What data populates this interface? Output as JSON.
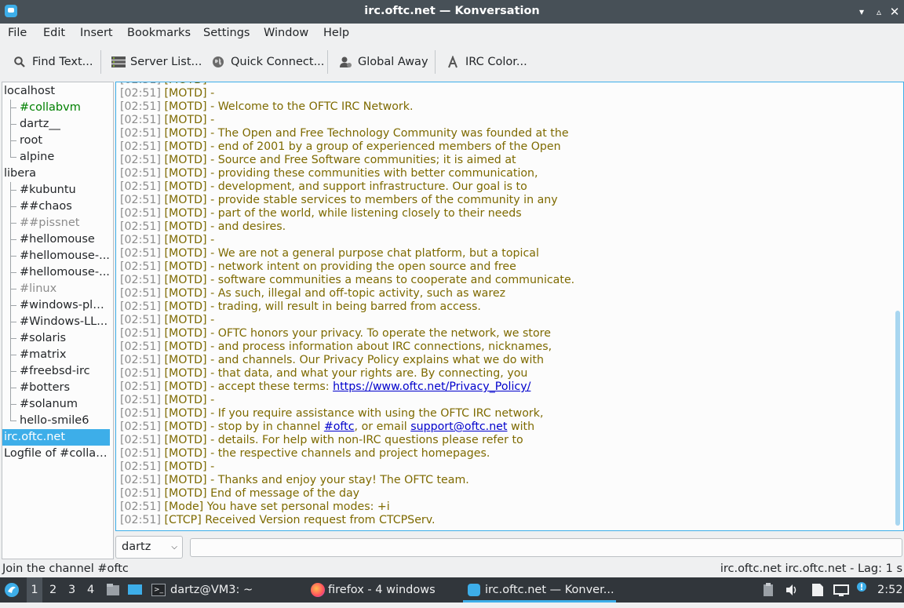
{
  "window": {
    "title": "irc.oftc.net — Konversation"
  },
  "menubar": [
    "File",
    "Edit",
    "Insert",
    "Bookmarks",
    "Settings",
    "Window",
    "Help"
  ],
  "toolbar": {
    "find": "Find Text...",
    "server_list": "Server List...",
    "quick_connect": "Quick Connect...",
    "global_away": "Global Away",
    "irc_color": "IRC Color..."
  },
  "tree": [
    {
      "label": "localhost",
      "level": 0
    },
    {
      "label": "#collabvm",
      "level": 1,
      "color": "#008000"
    },
    {
      "label": "dartz__",
      "level": 1
    },
    {
      "label": "root",
      "level": 1
    },
    {
      "label": "alpine",
      "level": 1
    },
    {
      "label": "libera",
      "level": 0
    },
    {
      "label": "#kubuntu",
      "level": 1
    },
    {
      "label": "##chaos",
      "level": 1
    },
    {
      "label": "##pissnet",
      "level": 1,
      "color": "#8c8c8c"
    },
    {
      "label": "#hellomouse",
      "level": 1
    },
    {
      "label": "#hellomouse-...",
      "level": 1
    },
    {
      "label": "#hellomouse-...",
      "level": 1
    },
    {
      "label": "#linux",
      "level": 1,
      "color": "#8c8c8c"
    },
    {
      "label": "#windows-ple...",
      "level": 1
    },
    {
      "label": "#Windows-LL...",
      "level": 1
    },
    {
      "label": "#solaris",
      "level": 1
    },
    {
      "label": "#matrix",
      "level": 1
    },
    {
      "label": "#freebsd-irc",
      "level": 1
    },
    {
      "label": "#botters",
      "level": 1
    },
    {
      "label": "#solanum",
      "level": 1
    },
    {
      "label": "hello-smile6",
      "level": 1
    },
    {
      "label": "irc.oftc.net",
      "level": 0,
      "selected": true
    },
    {
      "label": "Logfile of #collab...",
      "level": 0
    }
  ],
  "chat": {
    "partial_top": {
      "ts": "[02:51]",
      "tag": "[MOTD]",
      "text": " -"
    },
    "lines": [
      {
        "ts": "[02:51]",
        "tag": "[MOTD]",
        "text": " -"
      },
      {
        "ts": "[02:51]",
        "tag": "[MOTD]",
        "text": " - Welcome to the OFTC IRC Network."
      },
      {
        "ts": "[02:51]",
        "tag": "[MOTD]",
        "text": " -"
      },
      {
        "ts": "[02:51]",
        "tag": "[MOTD]",
        "text": " - The Open and Free Technology Community was founded at the"
      },
      {
        "ts": "[02:51]",
        "tag": "[MOTD]",
        "text": " - end of 2001 by a group of experienced members of the Open"
      },
      {
        "ts": "[02:51]",
        "tag": "[MOTD]",
        "text": " - Source and Free Software communities; it is aimed at"
      },
      {
        "ts": "[02:51]",
        "tag": "[MOTD]",
        "text": " - providing these communities with better communication,"
      },
      {
        "ts": "[02:51]",
        "tag": "[MOTD]",
        "text": " - development, and support infrastructure. Our goal is to"
      },
      {
        "ts": "[02:51]",
        "tag": "[MOTD]",
        "text": " - provide stable services to members of the community in any"
      },
      {
        "ts": "[02:51]",
        "tag": "[MOTD]",
        "text": " - part of the world, while listening closely to their needs"
      },
      {
        "ts": "[02:51]",
        "tag": "[MOTD]",
        "text": " - and desires."
      },
      {
        "ts": "[02:51]",
        "tag": "[MOTD]",
        "text": " -"
      },
      {
        "ts": "[02:51]",
        "tag": "[MOTD]",
        "text": " - We are not a general purpose chat platform, but a topical"
      },
      {
        "ts": "[02:51]",
        "tag": "[MOTD]",
        "text": " - network intent on providing the open source and free"
      },
      {
        "ts": "[02:51]",
        "tag": "[MOTD]",
        "text": " - software communities a means to cooperate and communicate."
      },
      {
        "ts": "[02:51]",
        "tag": "[MOTD]",
        "text": " - As such, illegal and off-topic activity, such as warez"
      },
      {
        "ts": "[02:51]",
        "tag": "[MOTD]",
        "text": " - trading, will result in being barred from access."
      },
      {
        "ts": "[02:51]",
        "tag": "[MOTD]",
        "text": " -"
      },
      {
        "ts": "[02:51]",
        "tag": "[MOTD]",
        "text": " - OFTC honors your privacy. To operate the network, we store"
      },
      {
        "ts": "[02:51]",
        "tag": "[MOTD]",
        "text": " - and process information about IRC connections, nicknames,"
      },
      {
        "ts": "[02:51]",
        "tag": "[MOTD]",
        "text": " - and channels. Our Privacy Policy explains what we do with"
      },
      {
        "ts": "[02:51]",
        "tag": "[MOTD]",
        "text": " - that data, and what your rights are. By connecting, you"
      },
      {
        "ts": "[02:51]",
        "tag": "[MOTD]",
        "text": " - accept these terms: ",
        "link": "https://www.oftc.net/Privacy_Policy/"
      },
      {
        "ts": "[02:51]",
        "tag": "[MOTD]",
        "text": " -"
      },
      {
        "ts": "[02:51]",
        "tag": "[MOTD]",
        "text": " - If you require assistance with using the OFTC IRC network,"
      },
      {
        "ts": "[02:51]",
        "tag": "[MOTD]",
        "text": " - stop by in channel ",
        "link": "#oftc",
        "text2": ", or email ",
        "link2": "support@oftc.net",
        "text3": " with"
      },
      {
        "ts": "[02:51]",
        "tag": "[MOTD]",
        "text": " - details. For help with non-IRC questions please refer to"
      },
      {
        "ts": "[02:51]",
        "tag": "[MOTD]",
        "text": " - the respective channels and project homepages."
      },
      {
        "ts": "[02:51]",
        "tag": "[MOTD]",
        "text": " -"
      },
      {
        "ts": "[02:51]",
        "tag": "[MOTD]",
        "text": " - Thanks and enjoy your stay! The OFTC team."
      },
      {
        "ts": "[02:51]",
        "tag": "[MOTD]",
        "text": " End of message of the day"
      },
      {
        "ts": "[02:51]",
        "tag": "[Mode]",
        "text": " You have set personal modes: +i"
      },
      {
        "ts": "[02:51]",
        "tag": "[CTCP]",
        "text": " Received Version request from CTCPServ."
      }
    ]
  },
  "input": {
    "nick": "dartz",
    "text": ""
  },
  "status": {
    "left": "Join the channel #oftc",
    "right": "irc.oftc.net  irc.oftc.net - Lag: 1 s"
  },
  "taskbar": {
    "desktops": [
      "1",
      "2",
      "3",
      "4"
    ],
    "tasks": [
      {
        "label": "dartz@VM3: ~",
        "icon": "terminal-icon"
      },
      {
        "label": "firefox - 4 windows",
        "icon": "firefox-icon"
      },
      {
        "label": "irc.oftc.net — Konver...",
        "icon": "konversation-icon",
        "active": true
      }
    ],
    "clock": "2:52"
  },
  "colors": {
    "accent": "#3daee9",
    "chat_text": "#7e6a00",
    "timestamp": "#8c8c8c",
    "titlebar": "#475057",
    "taskbar": "#31363b"
  }
}
